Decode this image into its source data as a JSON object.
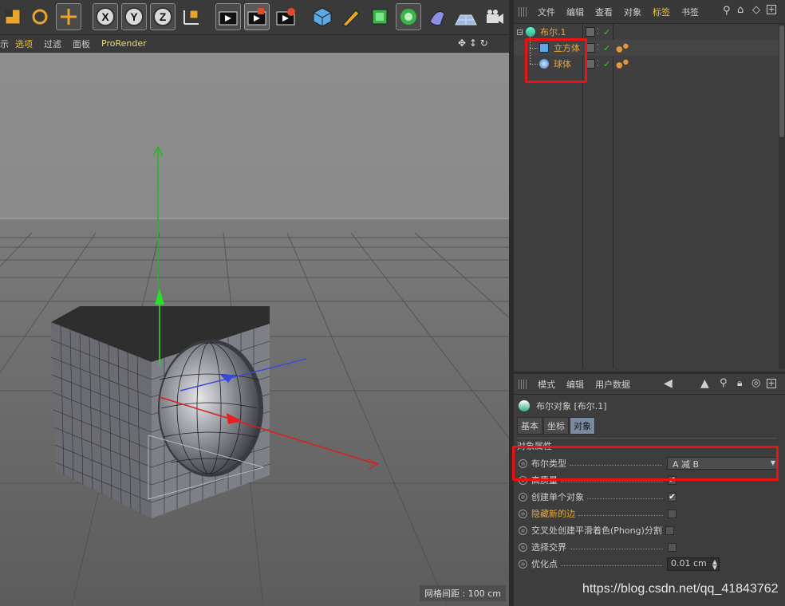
{
  "viewport_menu": {
    "items": [
      "示",
      "选项",
      "过滤",
      "面板",
      "ProRender"
    ]
  },
  "grid_spacing": "网格间距 : 100 cm",
  "obj_menu": [
    "文件",
    "编辑",
    "查看",
    "对象",
    "标签",
    "书签"
  ],
  "objects": [
    {
      "label": "布尔.1"
    },
    {
      "label": "立方体"
    },
    {
      "label": "球体"
    }
  ],
  "attr_menu": [
    "模式",
    "编辑",
    "用户数据"
  ],
  "attr_title": "布尔对象 [布尔.1]",
  "attr_tabs": [
    "基本",
    "坐标",
    "对象"
  ],
  "section_title": "对象属性",
  "props": [
    {
      "label": "布尔类型",
      "value": "A 减 B"
    },
    {
      "label": "高质量",
      "check": "✔"
    },
    {
      "label": "创建单个对象",
      "check": "✔"
    },
    {
      "label": "隐藏新的边",
      "check": ""
    },
    {
      "label": "交叉处创建平滑着色(Phong)分割",
      "check": ""
    },
    {
      "label": "选择交界",
      "check": ""
    },
    {
      "label": "优化点",
      "value": "0.01 cm"
    }
  ],
  "watermark": "https://blog.csdn.net/qq_41843762"
}
